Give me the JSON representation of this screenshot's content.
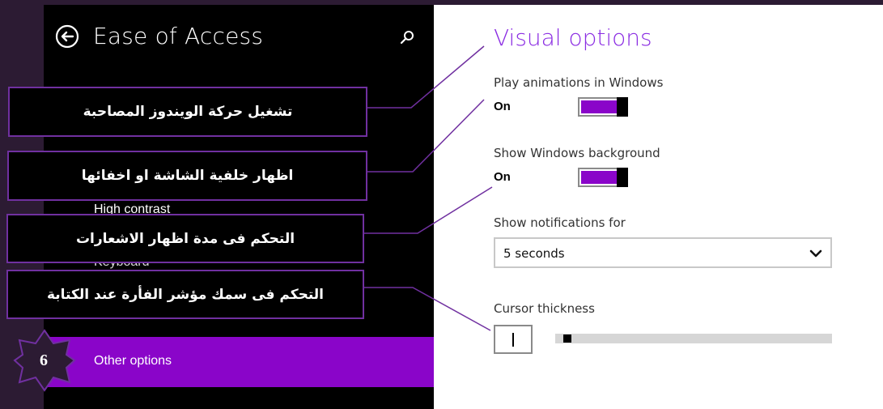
{
  "app": {
    "title": "Ease of Access",
    "section_title": "Visual options"
  },
  "sidebar": {
    "items": [
      {
        "label": "High contrast"
      },
      {
        "label": "Keyboard"
      },
      {
        "label": "Other options",
        "selected": true
      }
    ]
  },
  "badge": {
    "number": "6"
  },
  "callouts": [
    {
      "text": "تشغيل حركة الويندوز المصاحبة"
    },
    {
      "text": "اظهار خلفية الشاشة او اخفائها"
    },
    {
      "text": "التحكم فى مدة اظهار الاشعارات"
    },
    {
      "text": "التحكم فى سمك مؤشر الفأرة عند الكتابة"
    }
  ],
  "settings": {
    "animations": {
      "label": "Play animations in Windows",
      "state": "On"
    },
    "background": {
      "label": "Show Windows background",
      "state": "On"
    },
    "notifications": {
      "label": "Show notifications for",
      "value": "5 seconds"
    },
    "cursor": {
      "label": "Cursor thickness",
      "level": 0.03
    }
  },
  "colors": {
    "accent": "#8a05c9",
    "title_accent": "#8a2be2",
    "callout_border": "#7030a0"
  },
  "icons": {
    "back": "back-arrow-circle-icon",
    "search": "search-icon",
    "chevron": "chevron-down-icon"
  }
}
